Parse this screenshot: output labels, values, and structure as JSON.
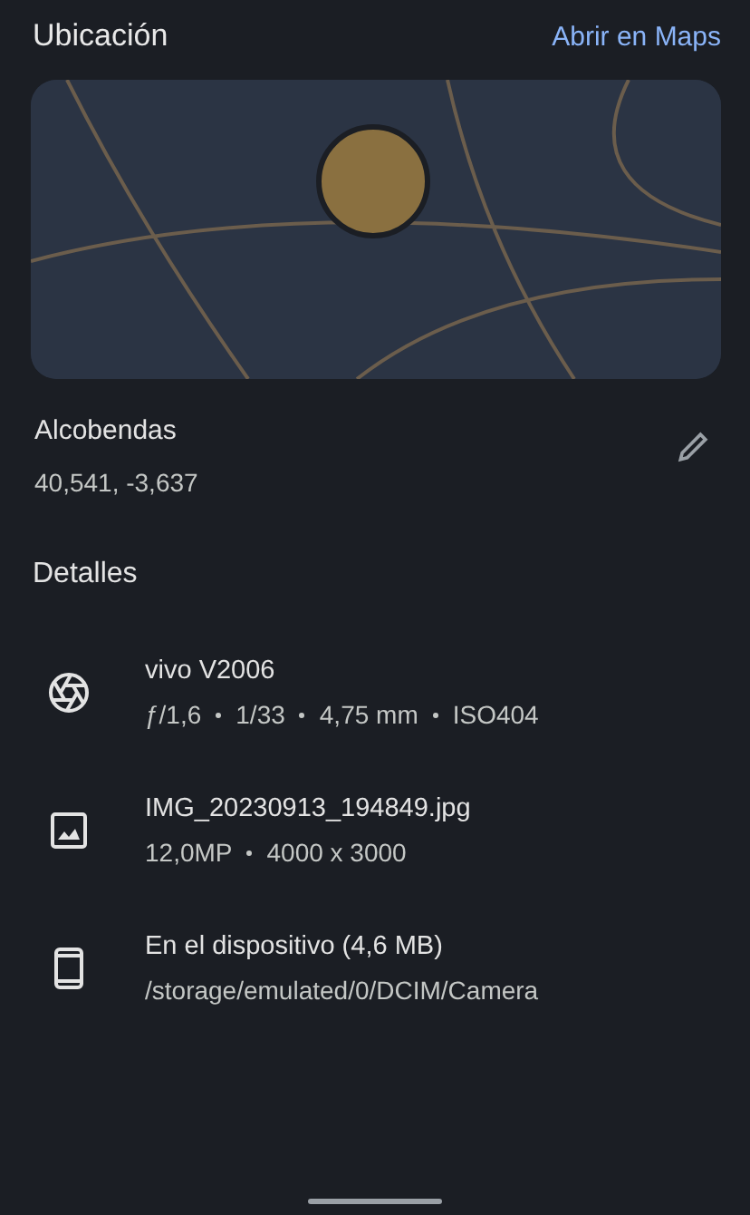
{
  "location": {
    "title": "Ubicación",
    "link": "Abrir en Maps",
    "place": "Alcobendas",
    "coordinates": "40,541, -3,637"
  },
  "details": {
    "title": "Detalles",
    "items": [
      {
        "kind": "camera",
        "title": "vivo V2006",
        "meta": [
          "ƒ/1,6",
          "1/33",
          "4,75 mm",
          "ISO404"
        ]
      },
      {
        "kind": "image",
        "title": "IMG_20230913_194849.jpg",
        "meta": [
          "12,0MP",
          "4000 x 3000"
        ]
      },
      {
        "kind": "device",
        "title": "En el dispositivo (4,6 MB)",
        "meta": [
          "/storage/emulated/0/DCIM/Camera"
        ]
      }
    ]
  }
}
